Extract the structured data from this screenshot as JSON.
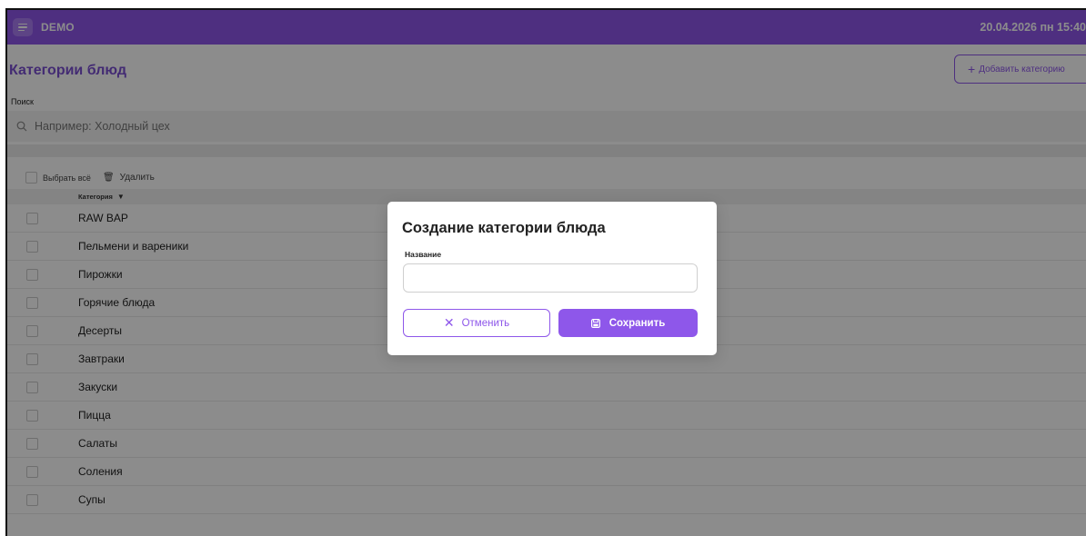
{
  "header": {
    "brand": "DEMO",
    "datetime": "20.04.2026 пн 15:40",
    "menu_icon": "menu-icon"
  },
  "page": {
    "title": "Категории блюд",
    "add_button_label": "Добавить категорию",
    "search": {
      "label": "Поиск",
      "placeholder": "Например: Холодный цех",
      "value": ""
    },
    "toolbar": {
      "select_all_label": "Выбрать всё",
      "delete_label": "Удалить"
    },
    "table": {
      "column_header": "Категория",
      "rows": [
        "RAW BAP",
        "Пельмени и вареники",
        "Пирожки",
        "Горячие блюда",
        "Десерты",
        "Завтраки",
        "Закуски",
        "Пицца",
        "Салаты",
        "Соления",
        "Супы"
      ]
    }
  },
  "modal": {
    "title": "Создание категории блюда",
    "field_label": "Название",
    "field_value": "",
    "cancel_label": "Отменить",
    "save_label": "Сохранить"
  },
  "colors": {
    "accent": "#8e57ea",
    "overlay": "rgba(0,0,0,0.45)"
  }
}
